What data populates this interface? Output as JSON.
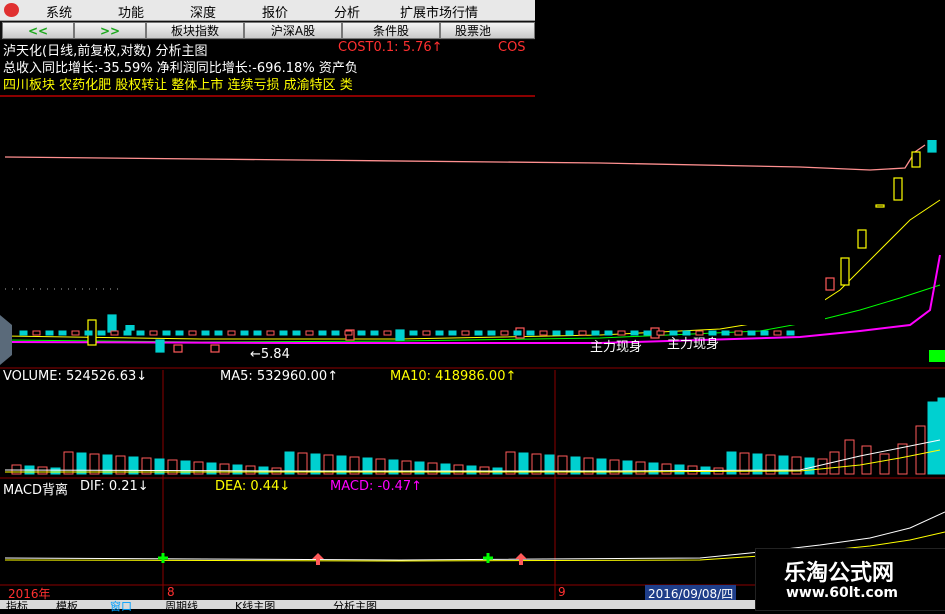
{
  "menubar": {
    "items": [
      "系统",
      "功能",
      "深度",
      "报价",
      "分析",
      "扩展市场行情"
    ]
  },
  "toolbar": {
    "prev": "<<",
    "next": ">>",
    "buttons": [
      "板块指数",
      "沪深A股",
      "条件股",
      "股票池"
    ]
  },
  "info": {
    "title": "泸天化(日线,前复权,对数) 分析主图",
    "cost": "COST0.1: 5.76↑",
    "cost2": "COS",
    "line2": "总收入同比增长:-35.59%  净利润同比增长:-696.18%  资产负",
    "tags": "四川板块 农药化肥 股权转让 整体上市 连续亏损 成渝特区 类"
  },
  "main_chart": {
    "low_marker": "←5.84",
    "signal1": "主力现身",
    "signal2": "主力现身"
  },
  "volume": {
    "label": "VOLUME: 524526.63↓",
    "ma5": "MA5: 532960.00↑",
    "ma10": "MA10: 418986.00↑"
  },
  "macd": {
    "label": "MACD背离",
    "dif": "DIF: 0.21↓",
    "dea": "DEA: 0.44↓",
    "macd": "MACD: -0.47↑"
  },
  "dates": {
    "year": "2016年",
    "m8": "8",
    "m9": "9",
    "cursor": "2016/09/08/四"
  },
  "bottom_tabs": [
    "指标",
    "模板",
    "窗口",
    "周期线",
    "K线主图",
    "分析主图"
  ],
  "watermark": {
    "name": "乐淘公式网",
    "url": "www.60lt.com"
  },
  "colors": {
    "up": "#ff5a5a",
    "down": "#00d0d0",
    "ma_white": "#ffffff",
    "ma_yellow": "#ffff00",
    "ma_green": "#00ff00",
    "ma_magenta": "#ff00ff",
    "panel_sep": "#8b0000"
  }
}
